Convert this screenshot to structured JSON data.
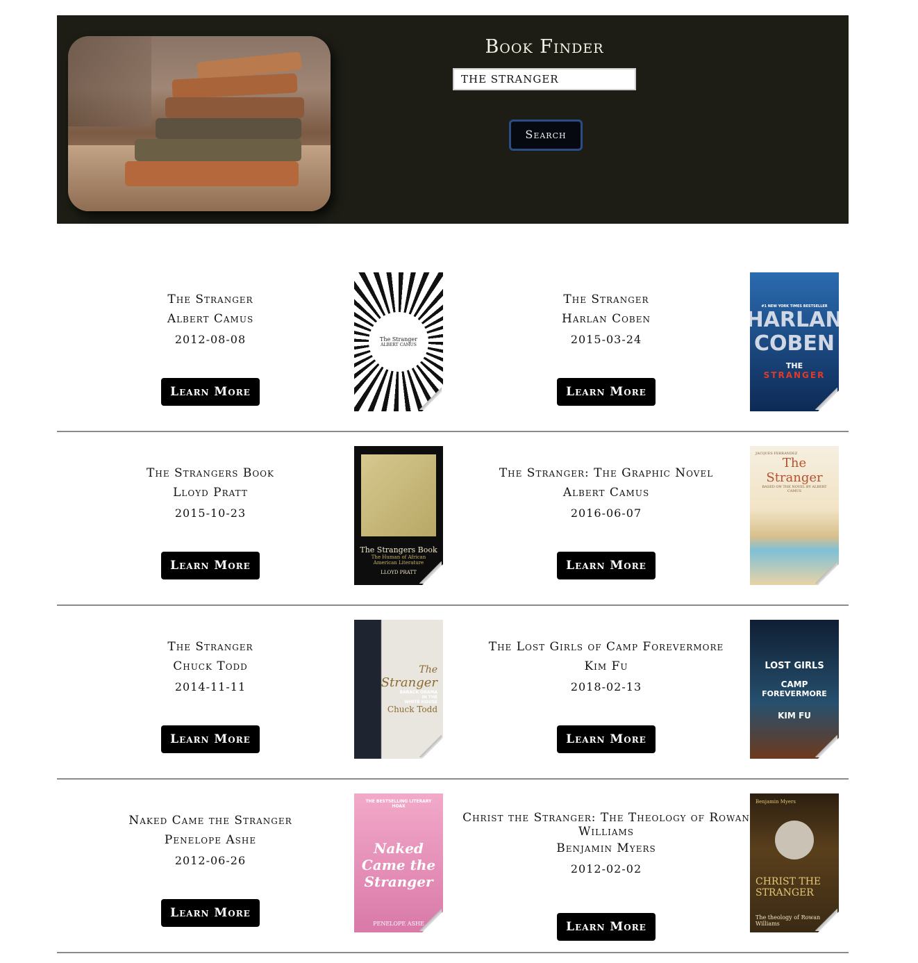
{
  "app": {
    "title": "Book Finder",
    "search": {
      "value": "THE STRANGER"
    },
    "search_label": "Search"
  },
  "results": [
    [
      {
        "title": "The Stranger",
        "author": "Albert Camus",
        "date": "2012-08-08",
        "button": "Learn More",
        "cover": {
          "lines": [
            "The Stranger",
            "ALBERT CAMUS"
          ],
          "bg": "#ffffff",
          "fg": "#222222"
        }
      },
      {
        "title": "The Stranger",
        "author": "Harlan Coben",
        "date": "2015-03-24",
        "button": "Learn More",
        "cover": {
          "lines": [
            "#1 NEW YORK TIMES BESTSELLER",
            "HARLAN COBEN",
            "THE",
            "STRANGER"
          ],
          "bg": "#1d4f8f",
          "fg": "#ffffff"
        }
      }
    ],
    [
      {
        "title": "The Strangers Book",
        "author": "Lloyd Pratt",
        "date": "2015-10-23",
        "button": "Learn More",
        "cover": {
          "lines": [
            "The Strangers Book",
            "The Human of African American Literature",
            "LLOYD PRATT"
          ],
          "bg": "#0d0d0d",
          "fg": "#e8dcb0"
        }
      },
      {
        "title": "The Stranger: The Graphic Novel",
        "author": "Albert Camus",
        "date": "2016-06-07",
        "button": "Learn More",
        "cover": {
          "lines": [
            "JACQUES FERRANDEZ",
            "The Stranger",
            "BASED ON THE NOVEL BY ALBERT CAMUS"
          ],
          "bg": "#f3ead7",
          "fg": "#b4522e"
        }
      }
    ],
    [
      {
        "title": "The Stranger",
        "author": "Chuck Todd",
        "date": "2014-11-11",
        "button": "Learn More",
        "cover": {
          "lines": [
            "The",
            "Stranger",
            "BARACK OBAMA",
            "IN THE",
            "WHITE HOUSE",
            "Chuck Todd"
          ],
          "bg": "#e9e6e0",
          "fg": "#8a6a2e"
        }
      },
      {
        "title": "The Lost Girls of Camp Forevermore",
        "author": "Kim Fu",
        "date": "2018-02-13",
        "button": "Learn More",
        "cover": {
          "lines": [
            "LOST",
            "GIRLS",
            "CAMP",
            "FOREVERMORE",
            "KIM FU"
          ],
          "bg": "#1f3f5b",
          "fg": "#ffffff"
        }
      }
    ],
    [
      {
        "title": "Naked Came the Stranger",
        "author": "Penelope Ashe",
        "date": "2012-06-26",
        "button": "Learn More",
        "cover": {
          "lines": [
            "THE BESTSELLING LITERARY HOAX",
            "Naked Came the Stranger",
            "PENELOPE ASHE"
          ],
          "bg": "#e887b7",
          "fg": "#ffffff"
        }
      },
      {
        "title": "Christ the Stranger: The Theology of Rowan Williams",
        "author": "Benjamin Myers",
        "date": "2012-02-02",
        "button": "Learn More",
        "cover": {
          "lines": [
            "Benjamin Myers",
            "CHRIST THE STRANGER",
            "The theology of Rowan Williams"
          ],
          "bg": "#3a2a14",
          "fg": "#e4c676"
        }
      }
    ]
  ]
}
